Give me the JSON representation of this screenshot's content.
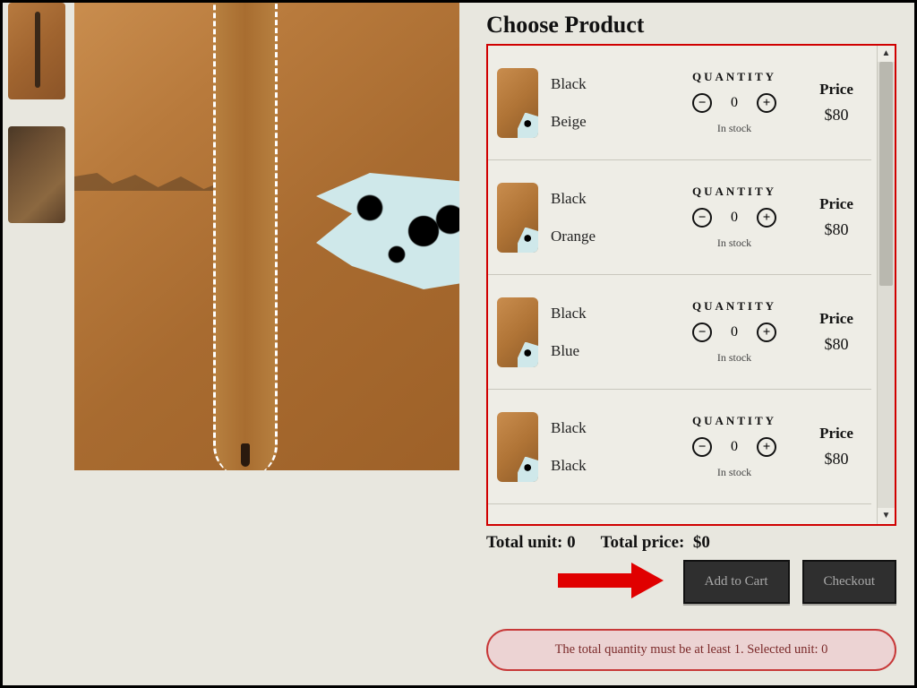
{
  "heading": "Choose Product",
  "quantity_label": "QUANTITY",
  "price_label": "Price",
  "stock_text": "In stock",
  "minus_glyph": "−",
  "plus_glyph": "+",
  "scroll_up_glyph": "▲",
  "scroll_down_glyph": "▼",
  "variants": [
    {
      "attr1": "Black",
      "attr2": "Beige",
      "qty": "0",
      "price": "$80"
    },
    {
      "attr1": "Black",
      "attr2": "Orange",
      "qty": "0",
      "price": "$80"
    },
    {
      "attr1": "Black",
      "attr2": "Blue",
      "qty": "0",
      "price": "$80"
    },
    {
      "attr1": "Black",
      "attr2": "Black",
      "qty": "0",
      "price": "$80"
    }
  ],
  "totals": {
    "unit_label": "Total unit:",
    "unit_value": "0",
    "price_label": "Total price:",
    "price_value": "$0"
  },
  "buttons": {
    "add_to_cart": "Add to Cart",
    "checkout": "Checkout"
  },
  "error_message": "The total quantity must be at least 1. Selected unit: 0"
}
